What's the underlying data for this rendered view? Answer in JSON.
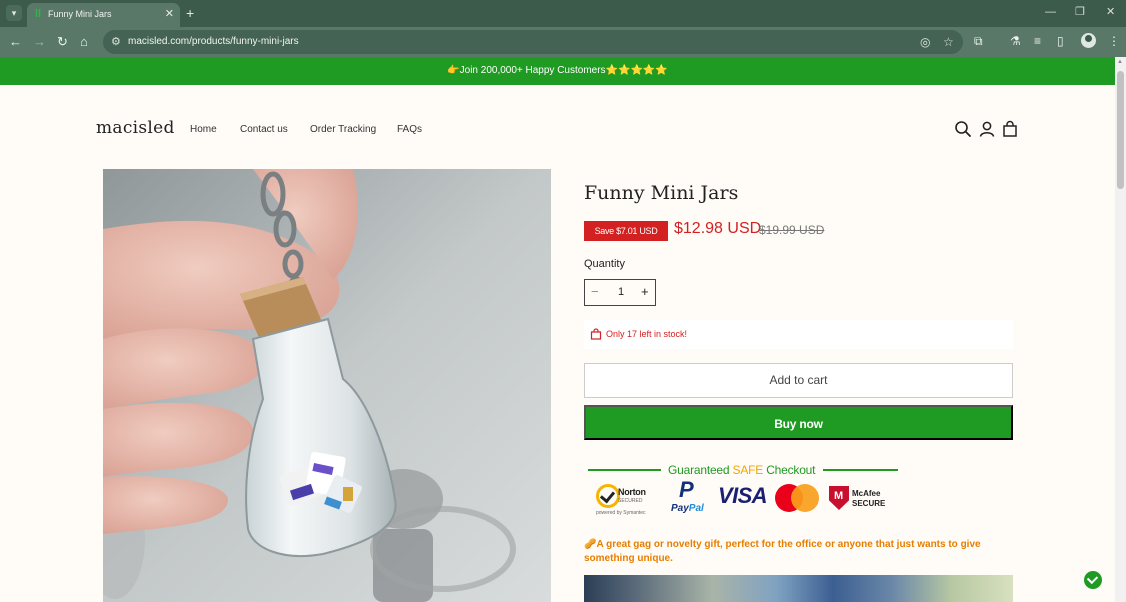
{
  "browser": {
    "tab_title": "Funny Mini Jars",
    "tab_favicon": "macisled-favicon",
    "url": "macisled.com/products/funny-mini-jars",
    "icons": [
      "tab-list-icon",
      "close-tab-icon",
      "new-tab-icon",
      "minimize-icon",
      "restore-icon",
      "close-window-icon",
      "back-icon",
      "forward-icon",
      "reload-icon",
      "home-icon",
      "site-info-icon",
      "eye-off-icon",
      "star-icon",
      "extensions-icon",
      "labs-icon",
      "media-icon",
      "sidebar-icon",
      "profile-icon",
      "menu-icon"
    ]
  },
  "announcement": {
    "text": "👉Join 200,000+ Happy Customers⭐⭐⭐⭐⭐"
  },
  "header": {
    "logo": "macisled",
    "nav": [
      "Home",
      "Contact us",
      "Order Tracking",
      "FAQs"
    ],
    "icons": [
      "search-icon",
      "account-icon",
      "cart-icon"
    ]
  },
  "product": {
    "title": "Funny Mini Jars",
    "save_badge": "Save $7.01 USD",
    "price": "$12.98 USD",
    "compare_price": "$19.99 USD",
    "quantity_label": "Quantity",
    "quantity": "1",
    "minus": "−",
    "plus": "+",
    "stock_text": "Only 17 left in stock!",
    "add_to_cart": "Add to cart",
    "buy_now": "Buy now",
    "description": "🥜A great gag or novelty gift, perfect for the office or anyone that just wants to give something unique."
  },
  "trust": {
    "title_prefix": "Guaranteed ",
    "title_safe": "SAFE",
    "title_suffix": " Checkout",
    "norton": "Norton",
    "norton_secured": "SECURED",
    "norton_by": "powered by Symantec",
    "paypal_p": "P",
    "paypal_pay": "Pay",
    "paypal_pal": "Pal",
    "visa": "VISA",
    "mcafee_m": "M",
    "mcafee_1": "McAfee",
    "mcafee_2": "SECURE"
  },
  "colors": {
    "brand_green": "#1f9a22",
    "sale_red": "#d32020",
    "safe_orange": "#f0a500",
    "desc_orange": "#e67e00",
    "chrome_dark": "#3c5b4b",
    "chrome_toolbar": "#5a7868"
  }
}
